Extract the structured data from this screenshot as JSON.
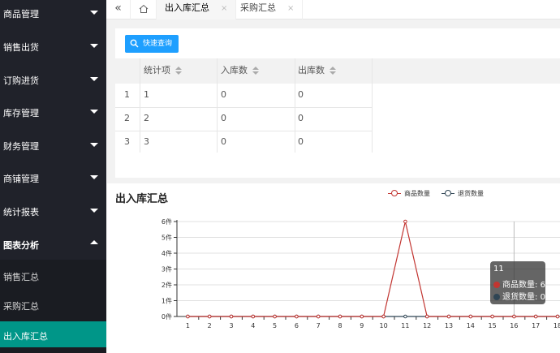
{
  "sidebar": {
    "items": [
      {
        "label": "商品管理",
        "expanded": false
      },
      {
        "label": "销售出货",
        "expanded": false
      },
      {
        "label": "订购进货",
        "expanded": false
      },
      {
        "label": "库存管理",
        "expanded": false
      },
      {
        "label": "财务管理",
        "expanded": false
      },
      {
        "label": "商铺管理",
        "expanded": false
      },
      {
        "label": "统计报表",
        "expanded": false
      },
      {
        "label": "图表分析",
        "expanded": true
      }
    ],
    "sub_items": [
      {
        "label": "销售汇总"
      },
      {
        "label": "采购汇总"
      },
      {
        "label": "出入库汇总",
        "active": true
      }
    ]
  },
  "tabs": {
    "back_icon": "«",
    "home_icon": "home-icon",
    "items": [
      {
        "label": "出入库汇总",
        "active": true
      },
      {
        "label": "采购汇总",
        "active": false
      }
    ],
    "close": "×"
  },
  "query": {
    "button_label": "快速查询"
  },
  "table": {
    "headers": [
      "统计项",
      "入库数",
      "出库数"
    ],
    "rows": [
      {
        "n": "1",
        "item": "1",
        "in": "0",
        "out": "0"
      },
      {
        "n": "2",
        "item": "2",
        "in": "0",
        "out": "0"
      },
      {
        "n": "3",
        "item": "3",
        "in": "0",
        "out": "0"
      }
    ]
  },
  "chart": {
    "title": "出入库汇总",
    "tooltip": {
      "x": "11",
      "rows": [
        {
          "name": "商品数量",
          "value": "6"
        },
        {
          "name": "退货数量",
          "value": "0"
        }
      ]
    }
  },
  "chart_data": {
    "type": "line",
    "title": "出入库汇总",
    "x": [
      "1",
      "2",
      "3",
      "4",
      "5",
      "6",
      "7",
      "8",
      "9",
      "10",
      "11",
      "12",
      "13",
      "14",
      "15",
      "16",
      "17",
      "18"
    ],
    "ylim": [
      0,
      6
    ],
    "yticks": [
      "0件",
      "1件",
      "2件",
      "3件",
      "4件",
      "5件",
      "6件"
    ],
    "grid": true,
    "legend": "top-right",
    "series": [
      {
        "name": "商品数量",
        "color": "#c23531",
        "values": [
          0,
          0,
          0,
          0,
          0,
          0,
          0,
          0,
          0,
          0,
          6,
          0,
          0,
          0,
          0,
          0,
          0,
          0
        ]
      },
      {
        "name": "退货数量",
        "color": "#2f4554",
        "values": [
          0,
          0,
          0,
          0,
          0,
          0,
          0,
          0,
          0,
          0,
          0,
          0,
          0,
          0,
          0,
          0,
          0,
          0
        ]
      }
    ]
  }
}
